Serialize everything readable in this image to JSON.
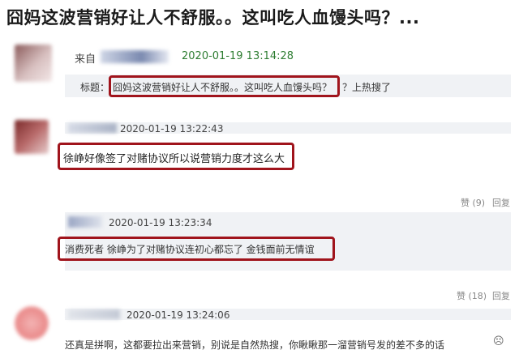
{
  "headline": "囧妈这波营销好让人不舒服。。这叫吃人血馒头吗？...",
  "post": {
    "source_label": "来自",
    "timestamp": "2020-01-19 13:14:28",
    "title_label": "标题：",
    "title_text": "囧妈这波营销好让人不舒服。。这叫吃人血馒头吗？",
    "title_suffix": "？上热搜了"
  },
  "comments": [
    {
      "timestamp": "2020-01-19 13:22:43",
      "text": "徐峥好像签了对赌协议所以说营销力度才这么大",
      "like_label": "赞 (9)",
      "reply_label": "回复"
    },
    {
      "timestamp": "2020-01-19 13:23:34",
      "text": "消费死者  徐峥为了对赌协议连初心都忘了  金钱面前无情谊",
      "like_label": "赞 (18)",
      "reply_label": "回复"
    },
    {
      "timestamp": "2020-01-19 13:24:06",
      "text": "还真是拼啊，这都要拉出来营销，别说是自然热搜，你瞅瞅那一溜营销号发的差不多的话",
      "emoji": "☹"
    }
  ],
  "colors": {
    "highlight_border": "#a0141c",
    "timestamp_green": "#2e7d32",
    "panel_bg": "#f0f2f5"
  }
}
